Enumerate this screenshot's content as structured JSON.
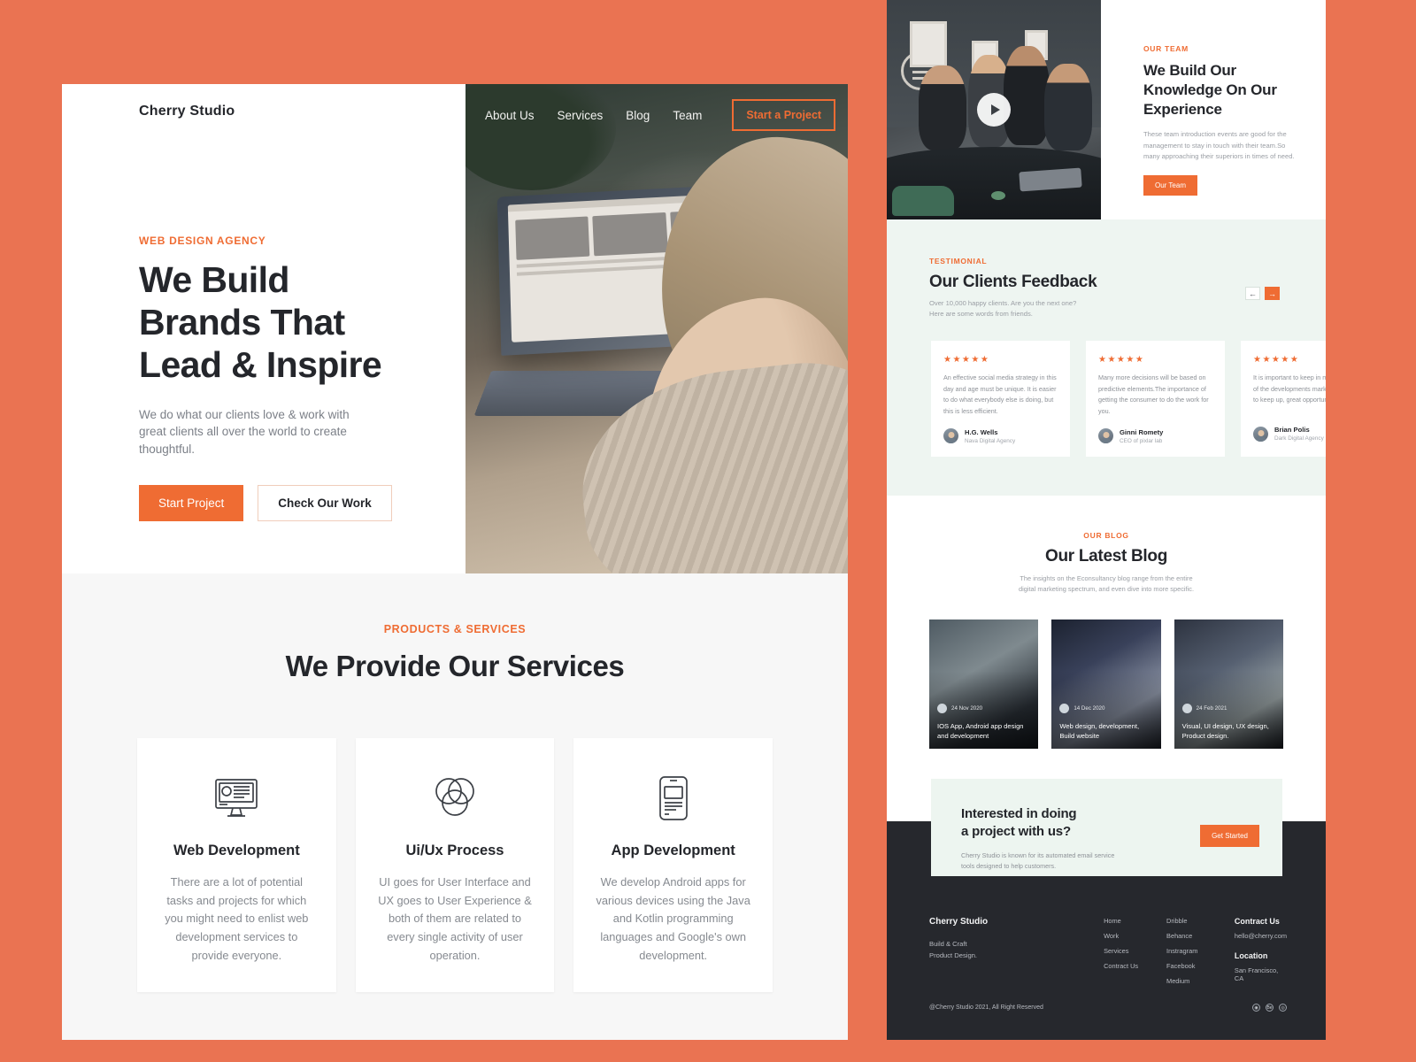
{
  "theme": {
    "page_bg": "#ea7352",
    "accent": "#ef6c33",
    "dark": "#24262b",
    "mint": "#eef5f1",
    "footer_bg": "#26282d"
  },
  "header": {
    "brand": "Cherry Studio",
    "nav": [
      {
        "label": "About Us"
      },
      {
        "label": "Services"
      },
      {
        "label": "Blog"
      },
      {
        "label": "Team"
      }
    ],
    "cta_label": "Start a Project"
  },
  "hero": {
    "eyebrow": "WEB DESIGN AGENCY",
    "title_line1": "We Build",
    "title_line2": "Brands That",
    "title_line3": "Lead & Inspire",
    "subtitle": "We do what our clients love & work with great clients all over the world to create thoughtful.",
    "primary_btn": "Start Project",
    "secondary_btn": "Check Our Work"
  },
  "services": {
    "eyebrow": "PRODUCTS & SERVICES",
    "title": "We Provide Our Services",
    "cards": [
      {
        "icon": "monitor-icon",
        "name": "Web Development",
        "desc": "There are a lot of potential tasks and projects for which you might need to enlist web development services to provide everyone."
      },
      {
        "icon": "venn-circles-icon",
        "name": "Ui/Ux Process",
        "desc": "UI goes for User Interface and UX goes to User Experience & both of them are related to every single activity of user operation."
      },
      {
        "icon": "mobile-phone-icon",
        "name": "App Development",
        "desc": "We develop Android apps for various devices using the Java and Kotlin programming languages and Google's own development."
      }
    ]
  },
  "team": {
    "eyebrow": "OUR TEAM",
    "title": "We Build Our Knowledge On Our Experience",
    "desc": "These team introduction events are good for the management to stay in touch with their team.So many approaching their superiors in times of need.",
    "btn": "Our Team",
    "play_icon": "play-icon"
  },
  "testimonial": {
    "eyebrow": "TESTIMONIAL",
    "title": "Our Clients Feedback",
    "sub_line1": "Over 10,000 happy clients. Are you the next one?",
    "sub_line2": "Here are some words from friends.",
    "prev_icon": "arrow-left-icon",
    "next_icon": "arrow-right-icon",
    "cards": [
      {
        "stars": "★★★★★",
        "text": "An effective social media strategy in this day and age must be unique. It is easier to do what everybody else is doing, but this is less efficient.",
        "name": "H.G. Wells",
        "role": "Nava Digital Agency"
      },
      {
        "stars": "★★★★★",
        "text": "Many more decisions will be based on predictive elements.The importance of getting the consumer to do the work for you.",
        "name": "Ginni Romety",
        "role": "CEO of pixlar lab"
      },
      {
        "stars": "★★★★★",
        "text": "It is important to keep in mind and size of the developments marketing. It's hard to keep up, great opportunity.",
        "name": "Brian Polis",
        "role": "Dark Digital Agency"
      }
    ]
  },
  "blog": {
    "eyebrow": "OUR BLOG",
    "title": "Our Latest Blog",
    "sub_line1": "The insights on the Econsultancy blog range from the entire",
    "sub_line2": "digital marketing spectrum, and even dive into more specific.",
    "cards": [
      {
        "date": "24 Nov 2020",
        "caption": "IOS App, Android app design and development"
      },
      {
        "date": "14 Dec 2020",
        "caption": "Web design, development, Build website"
      },
      {
        "date": "24 Feb 2021",
        "caption": "Visual, UI design, UX design, Product design."
      }
    ]
  },
  "cta": {
    "title_line1": "Interested in doing",
    "title_line2": "a project with us?",
    "sub": "Cherry Studio is known for its automated email service tools designed to help customers.",
    "btn": "Get Started"
  },
  "footer": {
    "brand": "Cherry Studio",
    "brand_sub_line1": "Build & Craft",
    "brand_sub_line2": "Product Design.",
    "links": [
      {
        "label": "Home"
      },
      {
        "label": "Work"
      },
      {
        "label": "Services"
      },
      {
        "label": "Contract Us"
      }
    ],
    "social_links": [
      {
        "label": "Dribble"
      },
      {
        "label": "Behance"
      },
      {
        "label": "Instragram"
      },
      {
        "label": "Facebook"
      },
      {
        "label": "Medium"
      }
    ],
    "contact_heading": "Contract Us",
    "contact_email": "hello@cherry.com",
    "location_heading": "Location",
    "location_value": "San Francisco, CA",
    "copyright": "@Cherry Studio 2021, All Right Reserved",
    "socials": [
      {
        "icon": "dribbble-icon",
        "glyph": "◉"
      },
      {
        "icon": "behance-icon",
        "glyph": "Be"
      },
      {
        "icon": "instagram-icon",
        "glyph": "◎"
      }
    ]
  }
}
